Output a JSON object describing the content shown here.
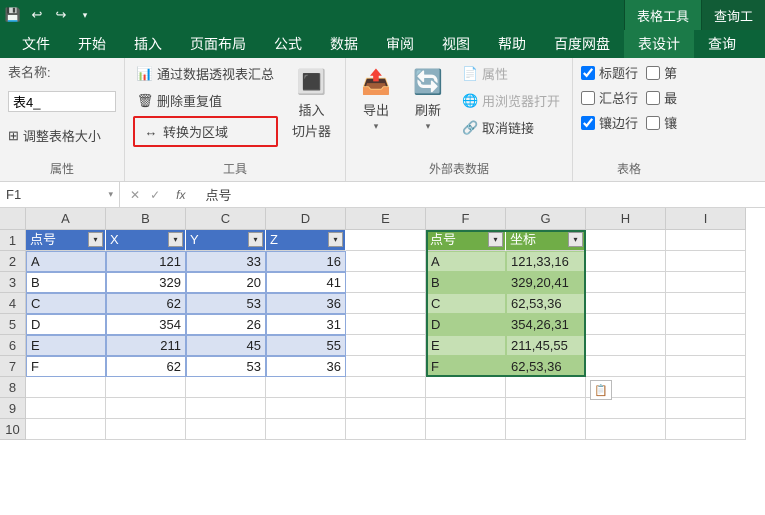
{
  "titlebar": {
    "context_tabs": [
      {
        "label": "表格工具",
        "active": true
      },
      {
        "label": "查询工",
        "active": false
      }
    ]
  },
  "ribbon_tabs": [
    {
      "label": "文件"
    },
    {
      "label": "开始"
    },
    {
      "label": "插入"
    },
    {
      "label": "页面布局"
    },
    {
      "label": "公式"
    },
    {
      "label": "数据"
    },
    {
      "label": "审阅"
    },
    {
      "label": "视图"
    },
    {
      "label": "帮助"
    },
    {
      "label": "百度网盘"
    },
    {
      "label": "表设计",
      "active": true
    },
    {
      "label": "查询"
    }
  ],
  "ribbon": {
    "props_group": {
      "label": "属性",
      "name_label": "表名称:",
      "name_value": "表4_",
      "resize": "调整表格大小"
    },
    "tools_group": {
      "label": "工具",
      "pivot": "通过数据透视表汇总",
      "dedup": "删除重复值",
      "to_range": "转换为区域",
      "slicer": "插入",
      "slicer2": "切片器"
    },
    "ext_group": {
      "label": "外部表数据",
      "export": "导出",
      "refresh": "刷新",
      "props": "属性",
      "browser": "用浏览器打开",
      "unlink": "取消链接"
    },
    "style_opts_group": {
      "label": "表格",
      "header_row": "标题行",
      "total_row": "汇总行",
      "banded_row": "镶边行",
      "first_col": "第",
      "last_col": "最",
      "banded_col": "镶"
    }
  },
  "formula_bar": {
    "name": "F1",
    "fx_value": "点号"
  },
  "columns": [
    "A",
    "B",
    "C",
    "D",
    "E",
    "F",
    "G",
    "H",
    "I"
  ],
  "rows": [
    "1",
    "2",
    "3",
    "4",
    "5",
    "6",
    "7",
    "8",
    "9",
    "10"
  ],
  "table1": {
    "headers": [
      "点号",
      "X",
      "Y",
      "Z"
    ],
    "rows": [
      {
        "k": "A",
        "x": "121",
        "y": "33",
        "z": "16"
      },
      {
        "k": "B",
        "x": "329",
        "y": "20",
        "z": "41"
      },
      {
        "k": "C",
        "x": "62",
        "y": "53",
        "z": "36"
      },
      {
        "k": "D",
        "x": "354",
        "y": "26",
        "z": "31"
      },
      {
        "k": "E",
        "x": "211",
        "y": "45",
        "z": "55"
      },
      {
        "k": "F",
        "x": "62",
        "y": "53",
        "z": "36"
      }
    ]
  },
  "table2": {
    "headers": [
      "点号",
      "坐标"
    ],
    "rows": [
      {
        "k": "A",
        "v": "121,33,16"
      },
      {
        "k": "B",
        "v": "329,20,41"
      },
      {
        "k": "C",
        "v": "62,53,36"
      },
      {
        "k": "D",
        "v": "354,26,31"
      },
      {
        "k": "E",
        "v": "211,45,55"
      },
      {
        "k": "F",
        "v": "62,53,36"
      }
    ]
  },
  "chart_data": null
}
